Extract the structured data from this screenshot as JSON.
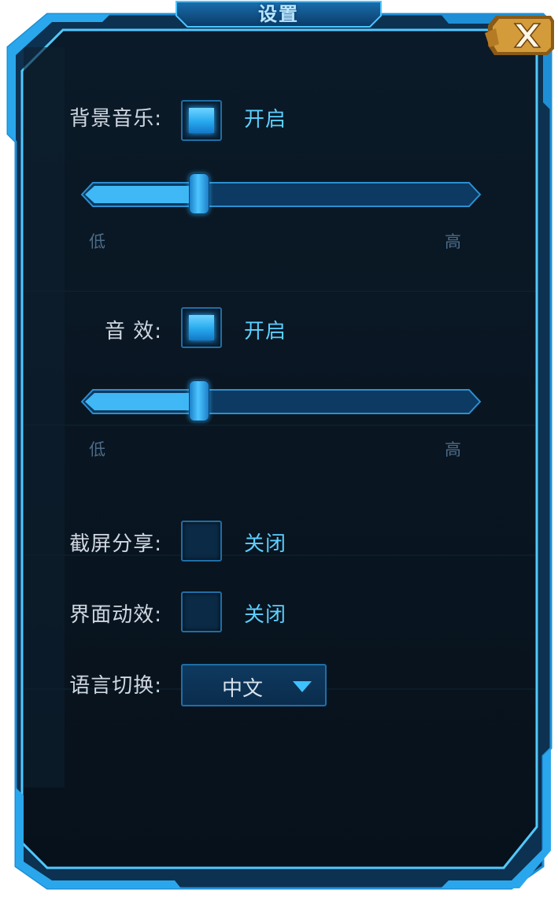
{
  "title": "设置",
  "close_icon": "close-x-icon",
  "music": {
    "label": "背景音乐:",
    "enabled": true,
    "state_text": "开启",
    "volume": 0.28,
    "low_label": "低",
    "high_label": "高"
  },
  "sfx": {
    "label": "音  效:",
    "enabled": true,
    "state_text": "开启",
    "volume": 0.28,
    "low_label": "低",
    "high_label": "高"
  },
  "screenshot_share": {
    "label": "截屏分享:",
    "enabled": false,
    "state_text": "关闭"
  },
  "ui_effects": {
    "label": "界面动效:",
    "enabled": false,
    "state_text": "关闭"
  },
  "language": {
    "label": "语言切换:",
    "selected": "中文"
  },
  "colors": {
    "accent": "#3fc1ff",
    "panel_bg": "#0a1520",
    "frame": "#2aa7ec",
    "close_gold": "#c9912e"
  }
}
